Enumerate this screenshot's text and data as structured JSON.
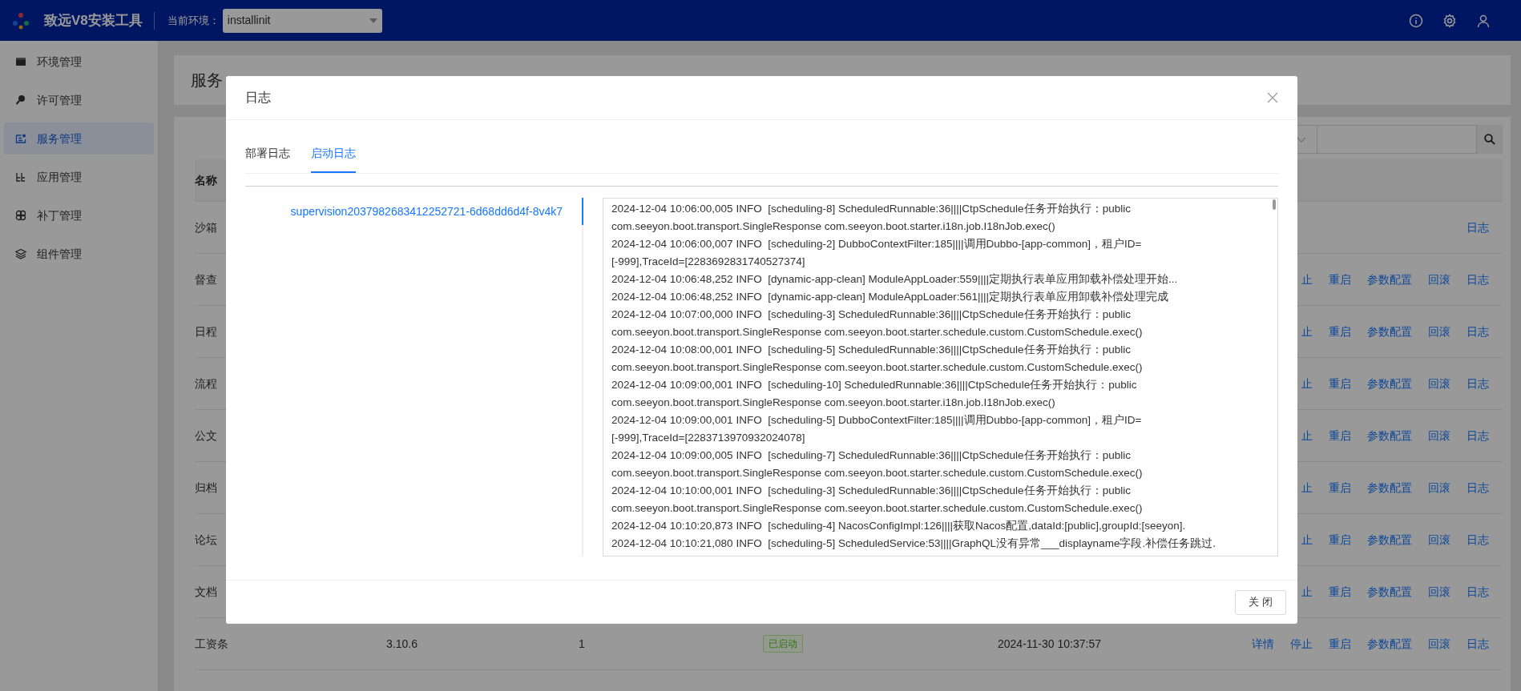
{
  "header": {
    "title": "致远V8安装工具",
    "env_label": "当前环境：",
    "env_value": "installinit"
  },
  "sidebar": {
    "items": [
      {
        "label": "环境管理",
        "selected": false
      },
      {
        "label": "许可管理",
        "selected": false
      },
      {
        "label": "服务管理",
        "selected": true
      },
      {
        "label": "应用管理",
        "selected": false
      },
      {
        "label": "补丁管理",
        "selected": false
      },
      {
        "label": "组件管理",
        "selected": false
      }
    ]
  },
  "page": {
    "title": "服务",
    "table": {
      "columns": [
        "名称"
      ],
      "rows": [
        {
          "name": "沙箱",
          "actions": [
            "日志"
          ]
        },
        {
          "name": "督查",
          "actions": [
            "止",
            "重启",
            "参数配置",
            "回滚",
            "日志"
          ]
        },
        {
          "name": "日程",
          "actions": [
            "止",
            "重启",
            "参数配置",
            "回滚",
            "日志"
          ]
        },
        {
          "name": "流程",
          "actions": [
            "止",
            "重启",
            "参数配置",
            "回滚",
            "日志"
          ]
        },
        {
          "name": "公文",
          "actions": [
            "止",
            "重启",
            "参数配置",
            "回滚",
            "日志"
          ]
        },
        {
          "name": "归档",
          "actions": [
            "止",
            "重启",
            "参数配置",
            "回滚",
            "日志"
          ]
        },
        {
          "name": "论坛",
          "actions": [
            "止",
            "重启",
            "参数配置",
            "回滚",
            "日志"
          ]
        },
        {
          "name": "文档",
          "actions": [
            "止",
            "重启",
            "参数配置",
            "回滚",
            "日志"
          ]
        },
        {
          "name": "工资条",
          "version": "3.10.6",
          "count": "1",
          "status": "已启动",
          "time": "2024-11-30 10:37:57",
          "actions": [
            "详情",
            "停止",
            "重启",
            "参数配置",
            "回滚",
            "日志"
          ]
        }
      ]
    }
  },
  "modal": {
    "title": "日志",
    "tabs": [
      {
        "label": "部署日志",
        "selected": false
      },
      {
        "label": "启动日志",
        "selected": true
      }
    ],
    "instances": [
      {
        "label": "supervision2037982683412252721-6d68dd6d4f-8v4k7",
        "selected": true
      }
    ],
    "log_lines": [
      "2024-12-04 10:06:00,005 INFO  [scheduling-8] ScheduledRunnable:36||||CtpSchedule任务开始执行：public",
      "com.seeyon.boot.transport.SingleResponse com.seeyon.boot.starter.i18n.job.I18nJob.exec()",
      "2024-12-04 10:06:00,007 INFO  [scheduling-2] DubboContextFilter:185||||调用Dubbo-[app-common]，租户ID=",
      "[-999],TraceId=[2283692831740527374]",
      "2024-12-04 10:06:48,252 INFO  [dynamic-app-clean] ModuleAppLoader:559||||定期执行表单应用卸载补偿处理开始...",
      "2024-12-04 10:06:48,252 INFO  [dynamic-app-clean] ModuleAppLoader:561||||定期执行表单应用卸载补偿处理完成",
      "2024-12-04 10:07:00,000 INFO  [scheduling-3] ScheduledRunnable:36||||CtpSchedule任务开始执行：public",
      "com.seeyon.boot.transport.SingleResponse com.seeyon.boot.starter.schedule.custom.CustomSchedule.exec()",
      "2024-12-04 10:08:00,001 INFO  [scheduling-5] ScheduledRunnable:36||||CtpSchedule任务开始执行：public",
      "com.seeyon.boot.transport.SingleResponse com.seeyon.boot.starter.schedule.custom.CustomSchedule.exec()",
      "2024-12-04 10:09:00,001 INFO  [scheduling-10] ScheduledRunnable:36||||CtpSchedule任务开始执行：public",
      "com.seeyon.boot.transport.SingleResponse com.seeyon.boot.starter.i18n.job.I18nJob.exec()",
      "2024-12-04 10:09:00,001 INFO  [scheduling-5] DubboContextFilter:185||||调用Dubbo-[app-common]，租户ID=",
      "[-999],TraceId=[2283713970932024078]",
      "2024-12-04 10:09:00,005 INFO  [scheduling-7] ScheduledRunnable:36||||CtpSchedule任务开始执行：public",
      "com.seeyon.boot.transport.SingleResponse com.seeyon.boot.starter.schedule.custom.CustomSchedule.exec()",
      "2024-12-04 10:10:00,001 INFO  [scheduling-3] ScheduledRunnable:36||||CtpSchedule任务开始执行：public",
      "com.seeyon.boot.transport.SingleResponse com.seeyon.boot.starter.schedule.custom.CustomSchedule.exec()",
      "2024-12-04 10:10:20,873 INFO  [scheduling-4] NacosConfigImpl:126||||获取Nacos配置,dataId:[public],groupId:[seeyon].",
      "2024-12-04 10:10:21,080 INFO  [scheduling-5] ScheduledService:53||||GraphQL没有异常___displayname字段.补偿任务跳过."
    ],
    "close_button": "关 闭"
  }
}
